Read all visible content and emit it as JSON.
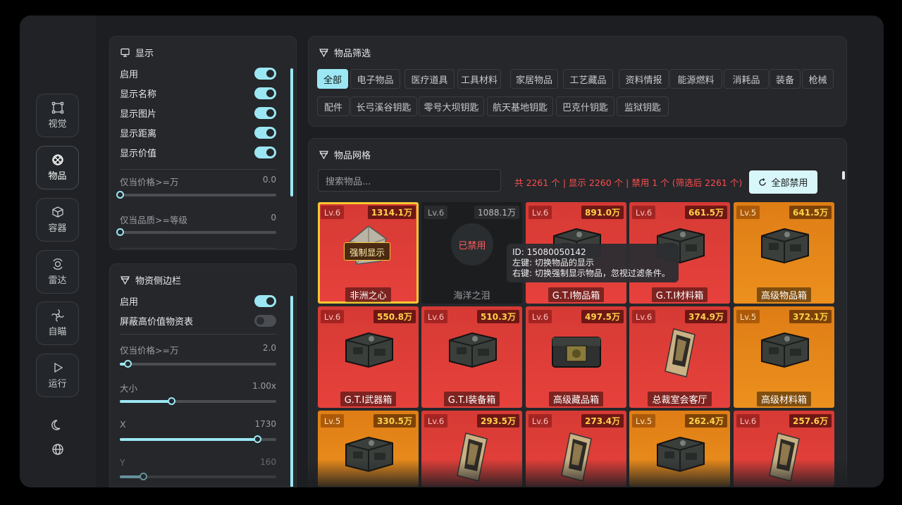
{
  "nav": {
    "items": [
      {
        "label": "视觉",
        "icon": "crop-frame-icon"
      },
      {
        "label": "物品",
        "icon": "diamond-icon"
      },
      {
        "label": "容器",
        "icon": "cube-icon"
      },
      {
        "label": "雷达",
        "icon": "radar-icon"
      },
      {
        "label": "自瞄",
        "icon": "crosshair-icon"
      },
      {
        "label": "运行",
        "icon": "play-icon"
      }
    ],
    "active": "物品"
  },
  "display_panel": {
    "title": "显示",
    "toggles": [
      {
        "label": "启用",
        "on": true
      },
      {
        "label": "显示名称",
        "on": true
      },
      {
        "label": "显示图片",
        "on": true
      },
      {
        "label": "显示距离",
        "on": true
      },
      {
        "label": "显示价值",
        "on": true
      }
    ],
    "sliders": [
      {
        "label": "仅当价格>=万",
        "value": "0.0",
        "fraction": 0.0
      },
      {
        "label": "仅当品质>=等级",
        "value": "0",
        "fraction": 0.0
      }
    ]
  },
  "sidebar_panel": {
    "title": "物资侧边栏",
    "toggles": [
      {
        "label": "启用",
        "on": true
      },
      {
        "label": "屏蔽高价值物资表",
        "on": false
      }
    ],
    "sliders": [
      {
        "label": "仅当价格>=万",
        "value": "2.0",
        "fraction": 0.05
      },
      {
        "label": "大小",
        "value": "1.00x",
        "fraction": 0.33
      },
      {
        "label": "X",
        "value": "1730",
        "fraction": 0.88
      },
      {
        "label": "Y",
        "value": "160",
        "fraction": 0.15
      }
    ]
  },
  "filter_panel": {
    "title": "物品筛选",
    "chips_row1": [
      "全部",
      "电子物品",
      "医疗道具",
      "工具材料",
      "家居物品",
      "工艺藏品",
      "资料情报",
      "能源燃料",
      "消耗品",
      "装备",
      "枪械"
    ],
    "chips_row2": [
      "配件",
      "长弓溪谷钥匙",
      "零号大坝钥匙",
      "航天基地钥匙",
      "巴克什钥匙",
      "监狱钥匙"
    ],
    "active": "全部"
  },
  "grid_panel": {
    "title": "物品网格",
    "search_placeholder": "搜索物品...",
    "stats": "共 2261 个 | 显示 2260 个 | 禁用 1 个 (筛选后 2261 个)",
    "disable_all": "全部禁用",
    "forced_label": "强制显示",
    "banned_label": "已禁用",
    "items": [
      {
        "lv": "Lv.6",
        "price": "1314.1万",
        "name": "非洲之心",
        "color": "red",
        "state": "forced",
        "art": "gem"
      },
      {
        "lv": "Lv.6",
        "price": "1088.1万",
        "name": "海洋之泪",
        "color": "dark",
        "state": "banned",
        "art": "none"
      },
      {
        "lv": "Lv.6",
        "price": "891.0万",
        "name": "G.T.I物品箱",
        "color": "red",
        "state": "",
        "art": "case"
      },
      {
        "lv": "Lv.6",
        "price": "661.5万",
        "name": "G.T.I材料箱",
        "color": "red",
        "state": "",
        "art": "case"
      },
      {
        "lv": "Lv.5",
        "price": "641.5万",
        "name": "高级物品箱",
        "color": "orange",
        "state": "",
        "art": "case"
      },
      {
        "lv": "Lv.6",
        "price": "550.8万",
        "name": "G.T.I武器箱",
        "color": "red",
        "state": "",
        "art": "case"
      },
      {
        "lv": "Lv.6",
        "price": "510.3万",
        "name": "G.T.I装备箱",
        "color": "red",
        "state": "",
        "art": "case"
      },
      {
        "lv": "Lv.6",
        "price": "497.5万",
        "name": "高级藏品箱",
        "color": "red",
        "state": "",
        "art": "chest"
      },
      {
        "lv": "Lv.6",
        "price": "374.9万",
        "name": "总裁室会客厅",
        "color": "red",
        "state": "",
        "art": "card"
      },
      {
        "lv": "Lv.5",
        "price": "372.1万",
        "name": "高级材料箱",
        "color": "orange",
        "state": "",
        "art": "case"
      },
      {
        "lv": "Lv.5",
        "price": "330.5万",
        "name": "",
        "color": "orange",
        "state": "",
        "art": "case"
      },
      {
        "lv": "Lv.6",
        "price": "293.5万",
        "name": "",
        "color": "red",
        "state": "",
        "art": "card"
      },
      {
        "lv": "Lv.6",
        "price": "273.4万",
        "name": "",
        "color": "red",
        "state": "",
        "art": "card"
      },
      {
        "lv": "Lv.5",
        "price": "262.4万",
        "name": "",
        "color": "orange",
        "state": "",
        "art": "case"
      },
      {
        "lv": "Lv.6",
        "price": "257.6万",
        "name": "",
        "color": "red",
        "state": "",
        "art": "card"
      }
    ]
  },
  "tooltip": {
    "id_line": "ID: 15080050142",
    "left_line": "左键: 切换物品的显示",
    "right_line": "右键: 切换强制显示物品，忽视过滤条件。"
  },
  "colors": {
    "accent": "#9be7f3",
    "red": "#e2403a",
    "orange": "#e8891b",
    "gold": "#f5c730",
    "warn": "#ff4d4d"
  }
}
